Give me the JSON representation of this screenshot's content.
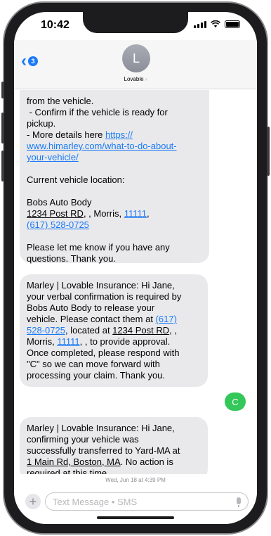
{
  "status_bar": {
    "time": "10:42"
  },
  "header": {
    "back_badge": "3",
    "avatar_initial": "L",
    "contact_name": "Lovable",
    "contact_chevron": "›"
  },
  "messages": {
    "m1": {
      "l1": "from the vehicle.",
      "l2": " - Confirm if the vehicle is ready for",
      "l3": "pickup.",
      "l4a": "- More details here ",
      "l4b": "https://",
      "l5": "www.himarley.com/what-to-do-about-",
      "l6": "your-vehicle/",
      "l7": "Current vehicle location:",
      "l8": "Bobs Auto Body",
      "l9a": "1234 Post RD",
      "l9b": ", , Morris, ",
      "l9c": "11111",
      "l9d": ",",
      "l10": "(617) 528-0725",
      "l11": "Please let me know if you have any",
      "l12": "questions. Thank you."
    },
    "m2": {
      "l1": "Marley | Lovable Insurance: Hi Jane,",
      "l2": "your verbal confirmation is required by",
      "l3": "Bobs Auto Body to release your",
      "l4a": "vehicle. Please contact them at ",
      "l4b": "(617)",
      "l5a": "528-0725",
      "l5b": ", located at ",
      "l5c": "1234 Post RD",
      "l5d": ", ,",
      "l6a": "Morris, ",
      "l6b": "11111",
      "l6c": ", , to provide approval.",
      "l7": "Once completed, please respond with",
      "l8": "\"C\" so we can move forward with",
      "l9": "processing your claim. Thank you."
    },
    "m3_out": "C",
    "m4": {
      "l1": "Marley | Lovable Insurance: Hi Jane,",
      "l2": "confirming your vehicle was",
      "l3": "successfully transferred to Yard-MA at",
      "l4a": "1 Main Rd, Boston, MA",
      "l4b": ". No action is",
      "l5": "required at this time."
    },
    "timestamp": "Wed, Jun 18 at 4:39 PM"
  },
  "input": {
    "placeholder": "Text Message • SMS"
  },
  "colors": {
    "link": "#1a7af8",
    "incoming": "#e9e9eb",
    "outgoing": "#34c759"
  },
  "icons": {
    "back": "chevron-left-icon",
    "plus": "plus-icon",
    "mic": "microphone-icon",
    "wifi": "wifi-icon",
    "signal": "signal-icon",
    "battery": "battery-icon"
  }
}
